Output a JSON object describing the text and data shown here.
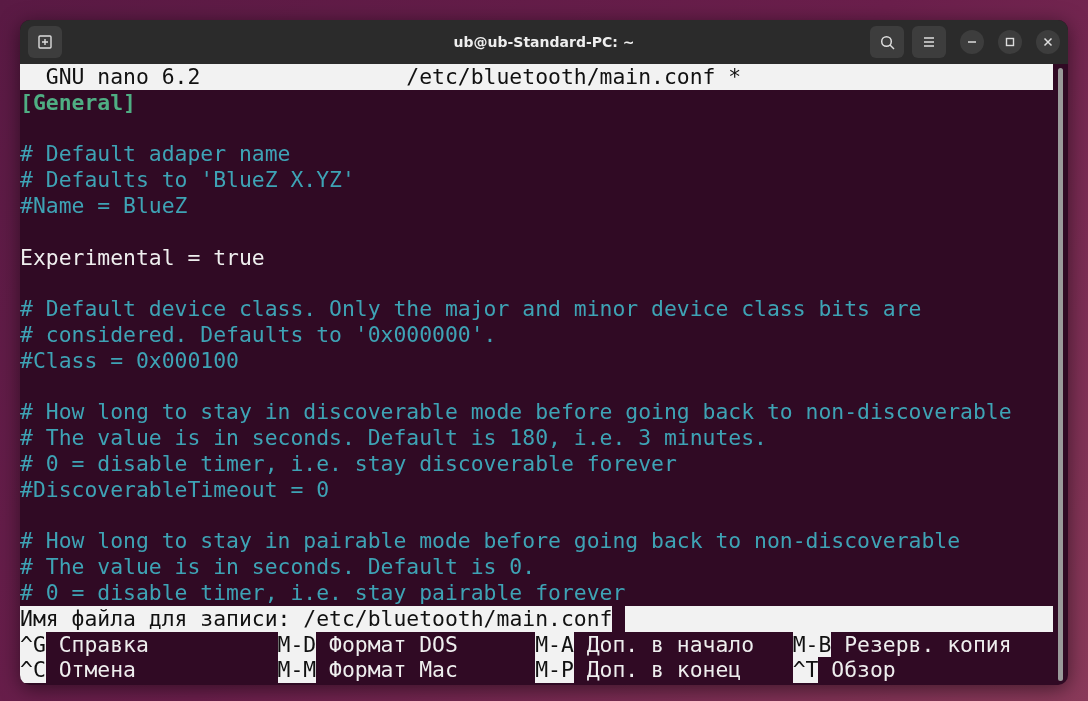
{
  "window": {
    "title": "ub@ub-Standard-PC: ~"
  },
  "editor": {
    "app": "GNU nano 6.2",
    "file": "/etc/bluetooth/main.conf *",
    "lines": [
      {
        "kind": "section",
        "text": "[General]"
      },
      {
        "kind": "blank"
      },
      {
        "kind": "comment",
        "text": "# Default adaper name"
      },
      {
        "kind": "comment",
        "text": "# Defaults to 'BlueZ X.YZ'"
      },
      {
        "kind": "comment",
        "text": "#Name = BlueZ"
      },
      {
        "kind": "blank"
      },
      {
        "kind": "setting",
        "text": "Experimental = true"
      },
      {
        "kind": "blank"
      },
      {
        "kind": "comment",
        "text": "# Default device class. Only the major and minor device class bits are"
      },
      {
        "kind": "comment",
        "text": "# considered. Defaults to '0x000000'."
      },
      {
        "kind": "comment",
        "text": "#Class = 0x000100"
      },
      {
        "kind": "blank"
      },
      {
        "kind": "comment",
        "text": "# How long to stay in discoverable mode before going back to non-discoverable"
      },
      {
        "kind": "comment",
        "text": "# The value is in seconds. Default is 180, i.e. 3 minutes."
      },
      {
        "kind": "comment",
        "text": "# 0 = disable timer, i.e. stay discoverable forever"
      },
      {
        "kind": "comment",
        "text": "#DiscoverableTimeout = 0"
      },
      {
        "kind": "blank"
      },
      {
        "kind": "comment",
        "text": "# How long to stay in pairable mode before going back to non-discoverable"
      },
      {
        "kind": "comment",
        "text": "# The value is in seconds. Default is 0."
      },
      {
        "kind": "comment",
        "text": "# 0 = disable timer, i.e. stay pairable forever"
      }
    ],
    "prompt": {
      "label": "Имя файла для записи:",
      "value": "/etc/bluetooth/main.conf"
    },
    "shortcuts": [
      [
        {
          "key": "^G",
          "label": "Справка"
        },
        {
          "key": "M-D",
          "label": "Формат DOS"
        },
        {
          "key": "M-A",
          "label": "Доп. в начало"
        },
        {
          "key": "M-B",
          "label": "Резерв. копия"
        }
      ],
      [
        {
          "key": "^C",
          "label": "Отмена"
        },
        {
          "key": "M-M",
          "label": "Формат Mac"
        },
        {
          "key": "M-P",
          "label": "Доп. в конец"
        },
        {
          "key": "^T",
          "label": "Обзор"
        }
      ]
    ]
  }
}
